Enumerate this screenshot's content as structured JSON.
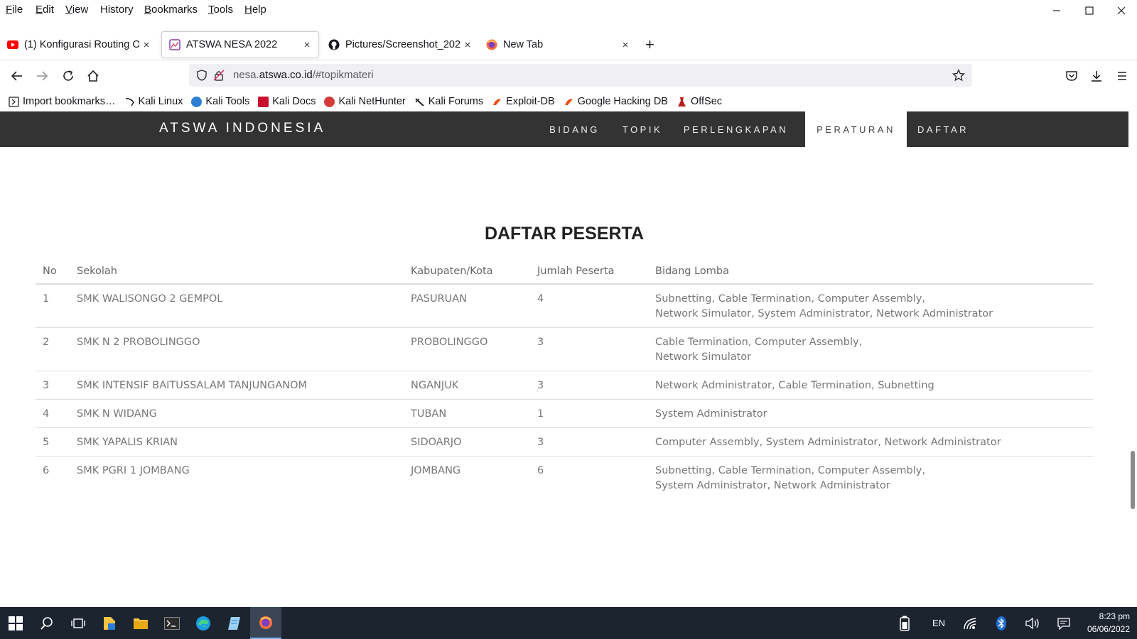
{
  "menubar": {
    "items": [
      {
        "label": "File",
        "u": "F",
        "rest": "ile"
      },
      {
        "label": "Edit",
        "u": "E",
        "rest": "dit"
      },
      {
        "label": "View",
        "u": "V",
        "rest": "iew"
      },
      {
        "label": "History",
        "u": "H",
        "pre": "",
        "rest": "istory"
      },
      {
        "label": "Bookmarks",
        "u": "B",
        "rest": "ookmarks"
      },
      {
        "label": "Tools",
        "u": "T",
        "rest": "ools"
      },
      {
        "label": "Help",
        "u": "H",
        "rest": "elp"
      }
    ]
  },
  "tabs": [
    {
      "title": "(1) Konfigurasi Routing O",
      "favicon": "youtube-icon",
      "active": false
    },
    {
      "title": "ATSWA NESA 2022",
      "favicon": "site-icon",
      "active": true
    },
    {
      "title": "Pictures/Screenshot_202",
      "favicon": "github-icon",
      "active": false
    },
    {
      "title": "New Tab",
      "favicon": "firefox-icon",
      "active": false
    }
  ],
  "tab_close_glyph": "×",
  "new_tab_glyph": "+",
  "urlbar": {
    "prefix": "nesa.",
    "host": "atswa.co.id",
    "path": "/#topikmateri"
  },
  "bookmarks": [
    {
      "label": "Import bookmarks…",
      "icon": "import-icon"
    },
    {
      "label": "Kali Linux",
      "icon": "kali-icon"
    },
    {
      "label": "Kali Tools",
      "icon": "kali-tools-icon"
    },
    {
      "label": "Kali Docs",
      "icon": "kali-docs-icon"
    },
    {
      "label": "Kali NetHunter",
      "icon": "nethunter-icon"
    },
    {
      "label": "Kali Forums",
      "icon": "kali-forums-icon"
    },
    {
      "label": "Exploit-DB",
      "icon": "exploitdb-icon"
    },
    {
      "label": "Google Hacking DB",
      "icon": "ghdb-icon"
    },
    {
      "label": "OffSec",
      "icon": "offsec-icon"
    }
  ],
  "site": {
    "brand": "ATSWA INDONESIA",
    "nav": [
      {
        "label": "BIDANG",
        "active": false
      },
      {
        "label": "TOPIK",
        "active": false
      },
      {
        "label": "PERLENGKAPAN",
        "active": false
      },
      {
        "label": "PERATURAN",
        "active": true
      },
      {
        "label": "DAFTAR",
        "active": false
      }
    ],
    "section_title": "DAFTAR PESERTA",
    "table": {
      "headers": [
        "No",
        "Sekolah",
        "Kabupaten/Kota",
        "Jumlah Peserta",
        "Bidang Lomba"
      ],
      "rows": [
        {
          "no": "1",
          "sekolah": "SMK WALISONGO 2 GEMPOL",
          "kota": "PASURUAN",
          "jumlah": "4",
          "bidang": [
            "Subnetting, Cable Termination, Computer Assembly,",
            "Network Simulator, System Administrator, Network Administrator"
          ]
        },
        {
          "no": "2",
          "sekolah": "SMK N 2 PROBOLINGGO",
          "kota": "PROBOLINGGO",
          "jumlah": "3",
          "bidang": [
            "Cable Termination, Computer Assembly,",
            "Network Simulator"
          ]
        },
        {
          "no": "3",
          "sekolah": "SMK INTENSIF BAITUSSALAM TANJUNGANOM",
          "kota": "NGANJUK",
          "jumlah": "3",
          "bidang": [
            "Network Administrator, Cable Termination, Subnetting"
          ]
        },
        {
          "no": "4",
          "sekolah": "SMK N WIDANG",
          "kota": "TUBAN",
          "jumlah": "1",
          "bidang": [
            "System Administrator"
          ]
        },
        {
          "no": "5",
          "sekolah": "SMK YAPALIS KRIAN",
          "kota": "SIDOARJO",
          "jumlah": "3",
          "bidang": [
            "Computer Assembly, System Administrator, Network Administrator"
          ]
        },
        {
          "no": "6",
          "sekolah": "SMK PGRI 1 JOMBANG",
          "kota": "JOMBANG",
          "jumlah": "6",
          "bidang": [
            "Subnetting, Cable Termination, Computer Assembly,",
            "System Administrator, Network Administrator"
          ]
        }
      ]
    }
  },
  "taskbar": {
    "language": "EN",
    "time": "8:23 pm",
    "date": "06/06/2022"
  },
  "colors": {
    "site_nav_bg": "#333333",
    "taskbar_bg": "#1c2430"
  }
}
